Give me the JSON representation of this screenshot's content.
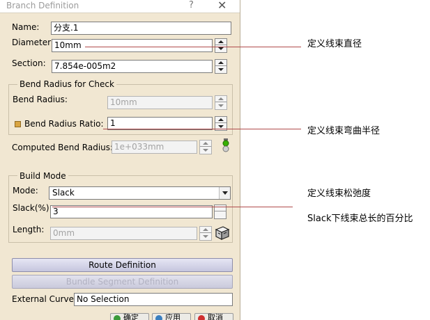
{
  "window": {
    "title": "Branch Definition",
    "help_glyph": "?",
    "close_glyph": "✕"
  },
  "name": {
    "label": "Name:",
    "value": "分支.1"
  },
  "diameter": {
    "label": "Diameter:",
    "value": "10mm"
  },
  "section": {
    "label": "Section:",
    "value": "7.854e-005m2"
  },
  "bend_check": {
    "frame_title": "Bend Radius for Check",
    "bend_radius": {
      "label": "Bend Radius:",
      "value": "10mm"
    },
    "bend_ratio": {
      "label": "Bend Radius Ratio:",
      "value": "1"
    }
  },
  "computed": {
    "label": "Computed Bend Radius:",
    "value": "1e+033mm"
  },
  "build_mode": {
    "frame_title": "Build Mode",
    "mode": {
      "label": "Mode:",
      "value": "Slack"
    },
    "slack": {
      "label": "Slack(%):",
      "value": "3"
    },
    "length": {
      "label": "Length:",
      "value": "0mm"
    }
  },
  "buttons": {
    "route_definition": "Route Definition",
    "bundle_segment_definition": "Bundle Segment Definition",
    "ok": "确定",
    "apply": "应用",
    "cancel": "取消"
  },
  "external_curve": {
    "label": "External Curve:",
    "value": "No Selection"
  },
  "annotations": {
    "diameter_note": "定义线束直径",
    "bend_ratio_note": "定义线束弯曲半径",
    "slack_note": "定义线束松弛度",
    "slack_desc": "Slack下线束总长的百分比"
  },
  "colors": {
    "dialog_bg": "#f1e7d2",
    "callout_line": "#b04a4a",
    "status_light_green": "#38b000",
    "ok_icon": "#3a9a3a",
    "apply_icon": "#3a7fc0",
    "cancel_icon": "#d03030"
  },
  "icons": {
    "status": "traffic-light-icon",
    "measure": "cube-measure-icon"
  }
}
